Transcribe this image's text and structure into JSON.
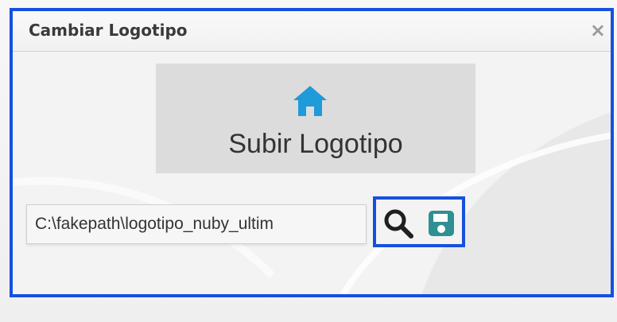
{
  "dialog": {
    "title": "Cambiar Logotipo",
    "close_glyph": "×",
    "close_icon": "close-icon"
  },
  "upload": {
    "label": "Subir Logotipo",
    "icon": "house-icon",
    "icon_color": "#1e9bd8"
  },
  "file": {
    "value": "C:\\fakepath\\logotipo_nuby_ultim"
  },
  "actions": {
    "search_icon": "search-icon",
    "save_icon": "floppy-disk-icon",
    "save_color": "#2f8f92"
  },
  "colors": {
    "highlight_border": "#1650e0"
  }
}
